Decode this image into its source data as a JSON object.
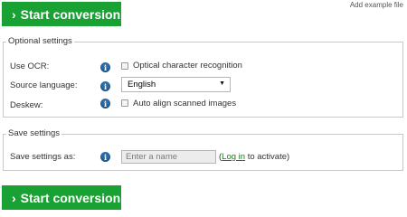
{
  "convert_button_top": {
    "label": "Start conversion",
    "icon": "chevron-right-icon"
  },
  "add_example_file": "Add example file",
  "optional_settings": {
    "legend": "Optional settings",
    "ocr_label": "Use OCR:",
    "ocr_checkbox_label": "Optical character recognition",
    "ocr_checked": false,
    "language_label": "Source language:",
    "language_value": "English",
    "deskew_label": "Deskew:",
    "deskew_checkbox_label": "Auto align scanned images",
    "deskew_checked": false
  },
  "save_settings": {
    "legend": "Save settings",
    "save_as_label": "Save settings as:",
    "name_placeholder": "Enter a name",
    "login_prefix": "(",
    "login_link": "Log in",
    "login_suffix": " to activate)"
  },
  "convert_button_bottom": {
    "label": "Start conversion",
    "icon": "chevron-right-icon"
  },
  "colors": {
    "accent": "#19a233",
    "info": "#2a6da8",
    "link": "#1a7a1a"
  }
}
